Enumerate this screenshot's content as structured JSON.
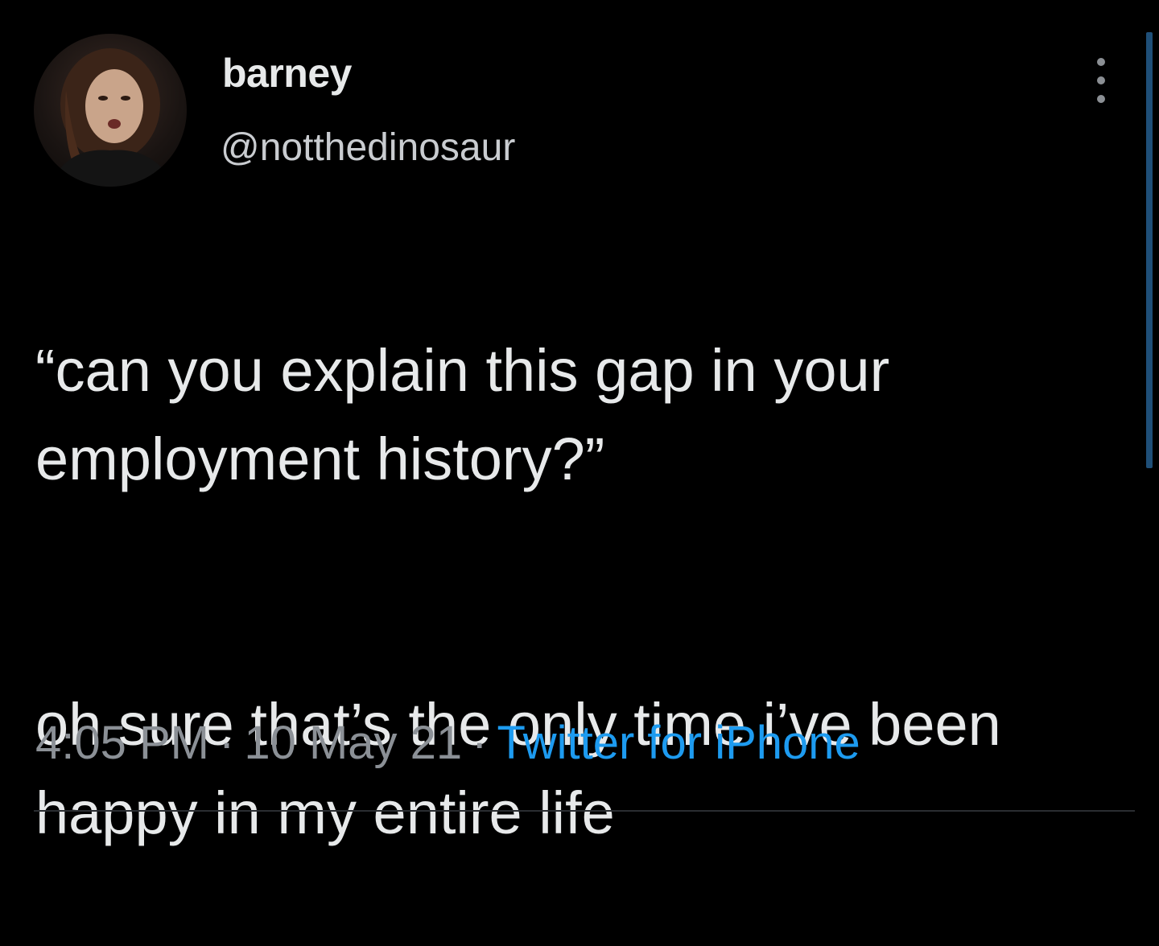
{
  "user": {
    "display_name": "barney",
    "handle": "@notthedinosaur",
    "avatar_icon": "profile-photo"
  },
  "tweet": {
    "paragraphs": [
      "“can you explain this gap in your employment history?”",
      "oh sure that’s the only time i’ve been happy in my entire life"
    ],
    "time": "4:05 PM",
    "date": "10 May 21",
    "separator": "·",
    "source": "Twitter for iPhone"
  },
  "colors": {
    "background": "#000000",
    "text": "#e7e9ea",
    "secondary": "#8b9096",
    "link": "#1d9bf0"
  },
  "icons": {
    "more": "vertical-ellipsis-icon"
  }
}
